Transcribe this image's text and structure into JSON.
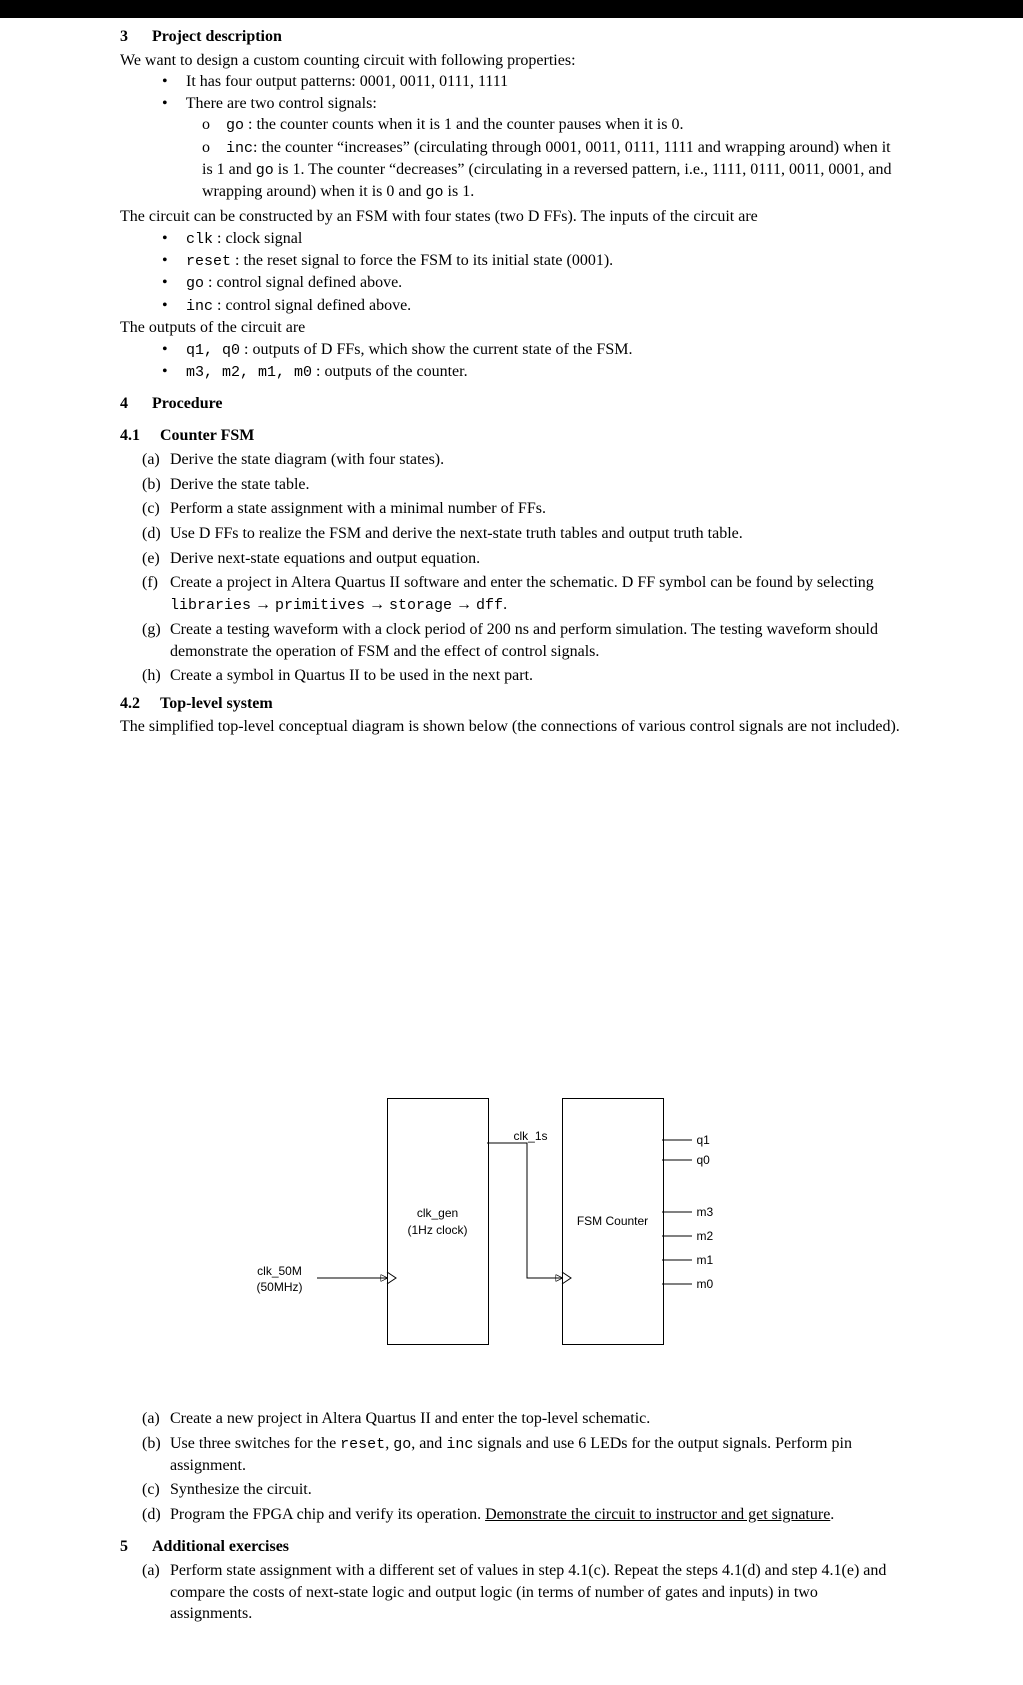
{
  "sec3": {
    "num": "3",
    "title": "Project description",
    "intro": "We want to design a custom counting circuit with following properties:",
    "b1": "It has four output patterns:  0001, 0011, 0111, 1111",
    "b2": "There are two control signals:",
    "go_label": "go",
    "go_text": ": the counter counts when it is 1 and the counter pauses when it is 0.",
    "inc_label": "inc",
    "inc_text_a": ": the counter “increases” (circulating through 0001, 0011, 0111, 1111 and wrapping around) when it is 1 and ",
    "inc_text_b": " is 1.  The counter “decreases” (circulating in a reversed pattern, i.e., 1111, 0111, 0011, 0001, and wrapping around) when it is 0 and ",
    "inc_text_c": " is 1.",
    "fsm": "The circuit can be constructed by an FSM with four states (two D FFs).  The inputs of the circuit are",
    "in_clk_l": "clk",
    "in_clk_t": ": clock signal",
    "in_rst_l": "reset",
    "in_rst_t": ": the reset signal to force the FSM to its initial state (0001).",
    "in_go_l": "go",
    "in_go_t": ": control signal defined above.",
    "in_inc_l": "inc",
    "in_inc_t": ": control signal defined above.",
    "out_intro": "The outputs of the circuit are",
    "out_q_l": "q1, q0",
    "out_q_t": ": outputs of D FFs, which show the current state of the FSM.",
    "out_m_l": "m3, m2, m1, m0",
    "out_m_t": ": outputs of the counter."
  },
  "sec4": {
    "num": "4",
    "title": "Procedure",
    "s1_num": "4.1",
    "s1_title": "Counter FSM",
    "a": "Derive the state diagram (with four states).",
    "b": "Derive the state table.",
    "c": "Perform a state assignment with a minimal number of FFs.",
    "d": "Use D FFs to realize the FSM and derive the next-state truth tables and output truth table.",
    "e": "Derive next-state equations and output equation.",
    "f_a": "Create a project in Altera Quartus II software and enter the schematic.  D FF symbol can be found by selecting ",
    "f_lib": "libraries",
    "f_prim": "primitives",
    "f_stor": "storage",
    "f_dff": "dff",
    "g": "Create a testing waveform with a clock period of 200 ns and perform simulation.  The testing waveform should demonstrate the operation of FSM and the effect of control signals.",
    "h": "Create a symbol in Quartus II to be used in the next part.",
    "s2_num": "4.2",
    "s2_title": "Top-level system",
    "s2_intro": "The simplified top-level conceptual diagram is shown below (the connections of various control signals are not included).",
    "ta": "Create a new project in Altera Quartus II and enter the top-level schematic.",
    "tb_a": "Use three switches for the ",
    "tb_b": ", and ",
    "tb_c": " signals and use 6 LEDs for the output signals.  Perform pin assignment.",
    "tc": "Synthesize the circuit.",
    "td_a": "Program the FPGA chip and verify its operation. ",
    "td_u": "Demonstrate the circuit to instructor and get signature",
    "td_p": "."
  },
  "diagram": {
    "clk50m_a": "clk_50M",
    "clk50m_b": "(50MHz)",
    "clkgen_a": "clk_gen",
    "clkgen_b": "(1Hz clock)",
    "clk1s": "clk_1s",
    "fsm": "FSM Counter",
    "q1": "q1",
    "q0": "q0",
    "m3": "m3",
    "m2": "m2",
    "m1": "m1",
    "m0": "m0"
  },
  "sec5": {
    "num": "5",
    "title": "Additional exercises",
    "a": "Perform state assignment with a different set of values in step 4.1(c).  Repeat the steps 4.1(d) and step 4.1(e) and compare the costs of next-state logic and output logic (in terms of number of gates and inputs) in two assignments."
  },
  "marks": {
    "la": "(a)",
    "lb": "(b)",
    "lc": "(c)",
    "ld": "(d)",
    "le": "(e)",
    "lf": "(f)",
    "lg": "(g)",
    "lh": "(h)",
    "arrow": " → ",
    "dot": "•",
    "odot": "o"
  }
}
